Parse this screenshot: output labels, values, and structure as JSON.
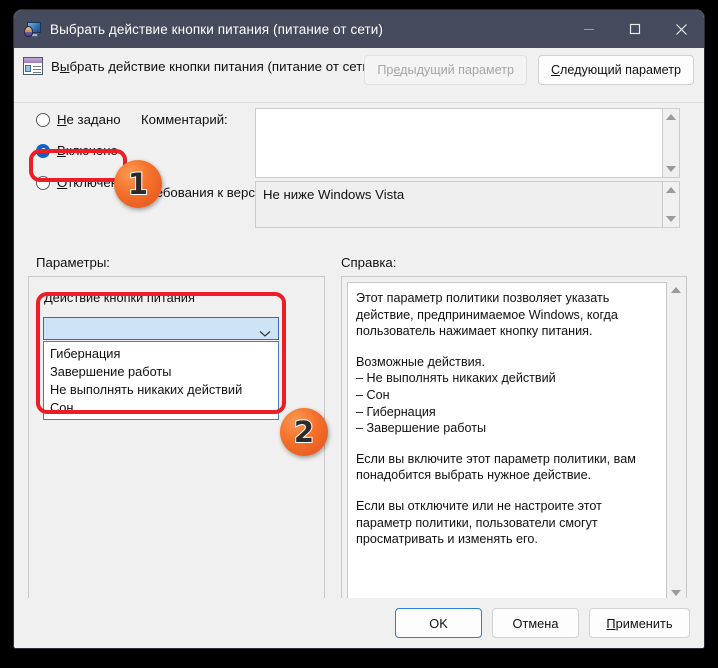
{
  "window": {
    "title": "Выбрать действие кнопки питания (питание от сети)",
    "title_icon": "monitor-user-icon",
    "minimize_icon": "minimize-icon",
    "maximize_icon": "maximize-icon",
    "close_icon": "close-icon"
  },
  "header": {
    "icon": "policy-setting-icon",
    "title": "Выбрать действие кнопки питания (питание от сети)",
    "prev_button": "Предыдущий параметр",
    "prev_mnemonic": "е",
    "next_button": "Следующий параметр",
    "next_mnemonic": "С"
  },
  "state": {
    "options": [
      {
        "label": "Не задано",
        "mnemonic": "Н",
        "selected": false
      },
      {
        "label": "Включено",
        "mnemonic": "В",
        "selected": true
      },
      {
        "label": "Отключено",
        "mnemonic": "О",
        "selected": false
      }
    ]
  },
  "comment": {
    "label": "Комментарий:",
    "value": ""
  },
  "version": {
    "label": "Требования к версии:",
    "value": "Не ниже Windows Vista"
  },
  "params": {
    "label": "Параметры:",
    "combo_label": "Действие кнопки питания",
    "combo_value": "",
    "chevron_icon": "chevron-down-icon",
    "options": [
      "Гибернация",
      "Завершение работы",
      "Не выполнять никаких действий",
      "Сон"
    ]
  },
  "help": {
    "label": "Справка:",
    "paragraphs": [
      "Этот параметр политики позволяет указать действие, предпринимаемое Windows, когда пользователь нажимает кнопку питания.",
      "Возможные действия.\n– Не выполнять никаких действий\n– Сон\n– Гибернация\n– Завершение работы",
      "Если вы включите этот параметр политики, вам понадобится выбрать нужное действие.",
      "Если вы отключите или не настроите этот параметр политики, пользователи смогут просматривать и изменять его."
    ],
    "scroll_up_icon": "scroll-up-arrow-icon",
    "scroll_down_icon": "scroll-down-arrow-icon"
  },
  "footer": {
    "ok": "OK",
    "cancel": "Отмена",
    "apply": "Применить",
    "apply_mnemonic": "П"
  },
  "annotations": {
    "badge_1": "1",
    "badge_2": "2",
    "highlight_color": "#ee1c25",
    "badge_color": "#f4712c"
  }
}
